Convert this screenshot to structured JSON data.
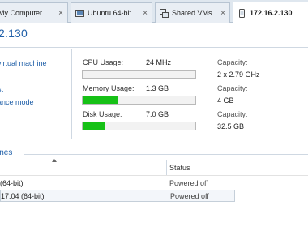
{
  "tabs": [
    {
      "label": "My Computer",
      "icon": "home-icon",
      "close": "×"
    },
    {
      "label": "Ubuntu 64-bit",
      "icon": "vm-icon",
      "close": "×"
    },
    {
      "label": "Shared VMs",
      "icon": "shared-vms-icon",
      "close": "×"
    },
    {
      "label": "172.16.2.130",
      "icon": "phone-host-icon",
      "active": true
    }
  ],
  "host": {
    "title": "2.130"
  },
  "tasks": [
    "virtual machine",
    "st",
    "ance mode"
  ],
  "stats": [
    {
      "label": "CPU Usage:",
      "value": "24 MHz",
      "fill": 0.0,
      "capacity_label": "Capacity:",
      "capacity_value": "2 x 2.79 GHz"
    },
    {
      "label": "Memory Usage:",
      "value": "1.3 GB",
      "fill": 0.31,
      "capacity_label": "Capacity:",
      "capacity_value": "4 GB"
    },
    {
      "label": "Disk Usage:",
      "value": "7.0 GB",
      "fill": 0.2,
      "capacity_label": "Capacity:",
      "capacity_value": "32.5 GB"
    }
  ],
  "bar_color": "#16c116",
  "machines": {
    "title": "ines",
    "status_header": "Status",
    "rows": [
      {
        "name": "(64-bit)",
        "status": "Powered off"
      },
      {
        "name": "17.04 (64-bit)",
        "status": "Powered off",
        "selected": true
      }
    ]
  }
}
